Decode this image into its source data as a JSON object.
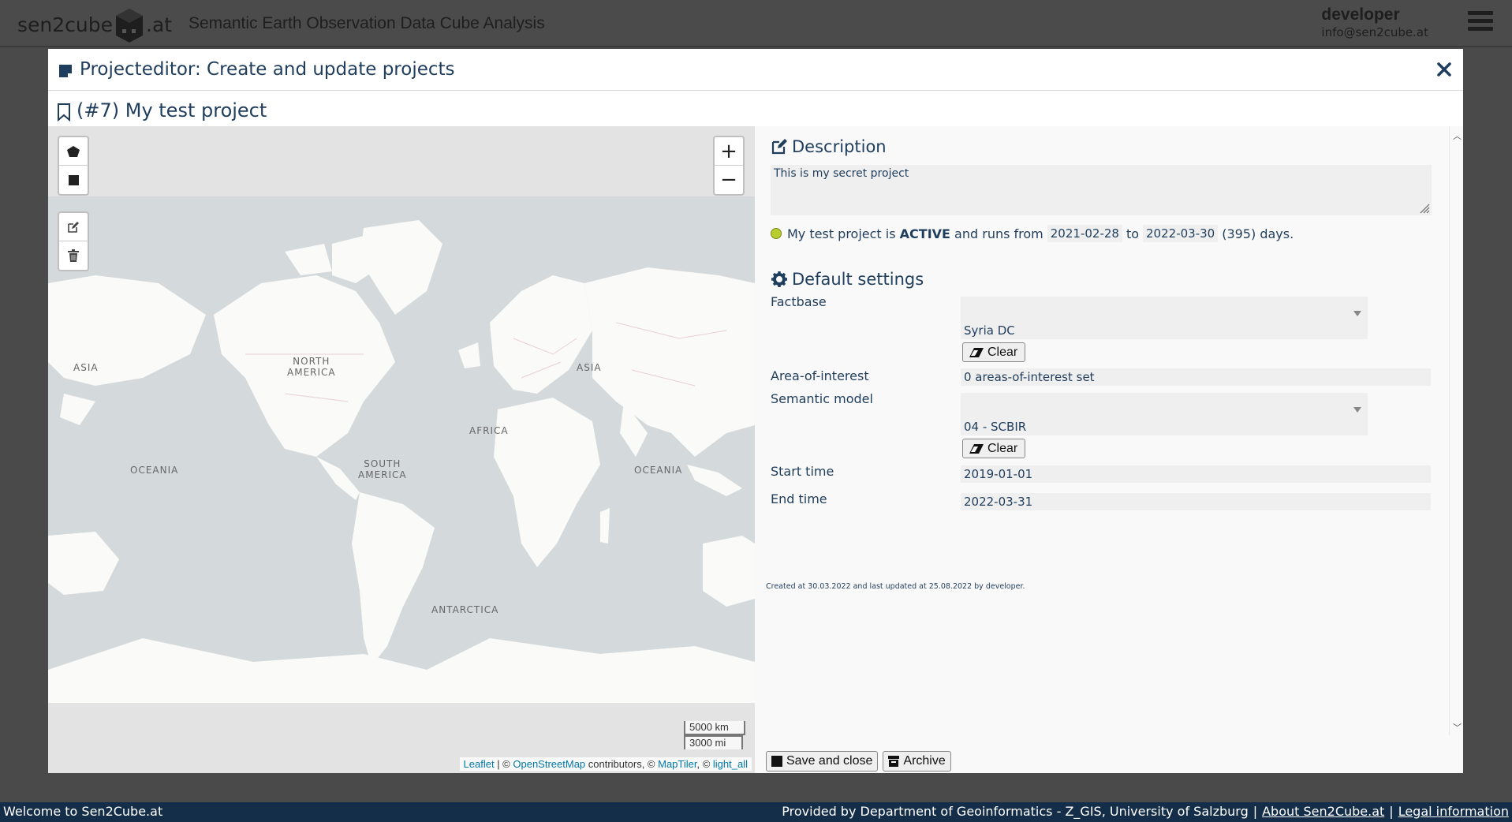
{
  "app": {
    "logo_left": "sen2cube",
    "logo_right": ".at",
    "title": "Semantic Earth Observation Data Cube Analysis",
    "user_name": "developer",
    "user_email": "info@sen2cube.at"
  },
  "modal": {
    "title": "Projecteditor: Create and update projects",
    "project_title": "(#7)  My test project"
  },
  "map": {
    "labels": {
      "asia_west": "ASIA",
      "north_america": "NORTH\nAMERICA",
      "asia": "ASIA",
      "africa": "AFRICA",
      "oceania_west": "OCEANIA",
      "south_america": "SOUTH\nAMERICA",
      "oceania": "OCEANIA",
      "antarctica": "ANTARCTICA"
    },
    "zoom_in": "+",
    "zoom_out": "−",
    "scale_km": "5000 km",
    "scale_mi": "3000 mi",
    "attribution": {
      "leaflet": "Leaflet",
      "sep1": " | © ",
      "osm": "OpenStreetMap",
      "contrib": " contributors, © ",
      "maptiler": "MapTiler",
      "sep2": ", © ",
      "light_all": "light_all"
    }
  },
  "description": {
    "heading": "Description",
    "text": "This is my secret project",
    "status_prefix": "My test project is ",
    "status_state": "ACTIVE",
    "status_mid": " and runs from",
    "start_date": "2021-02-28",
    "to": "to",
    "end_date": "2022-03-30",
    "days": "(395) days."
  },
  "settings": {
    "heading": "Default settings",
    "factbase_label": "Factbase",
    "factbase_value": "Syria DC",
    "clear_label": "Clear",
    "aoi_label": "Area-of-interest",
    "aoi_value": "0 areas-of-interest set",
    "semantic_model_label": "Semantic model",
    "semantic_model_value": "04 - SCBIR",
    "start_time_label": "Start time",
    "start_time_value": "2019-01-01",
    "end_time_label": "End time",
    "end_time_value": "2022-03-31"
  },
  "meta": "Created at 30.03.2022 and last updated at 25.08.2022 by developer.",
  "footer": {
    "save_close": "Save and close",
    "archive": "Archive"
  },
  "statusbar": {
    "welcome": "Welcome to Sen2Cube.at",
    "provided": "Provided by Department of Geoinformatics - Z_GIS, University of Salzburg",
    "about": "About Sen2Cube.at",
    "legal": "Legal information",
    "sep": "|"
  },
  "colors": {
    "text_primary": "#1f3d5c",
    "status_active": "#b8cd2e",
    "statusbar_bg": "#142d48",
    "link": "#0078a8"
  }
}
